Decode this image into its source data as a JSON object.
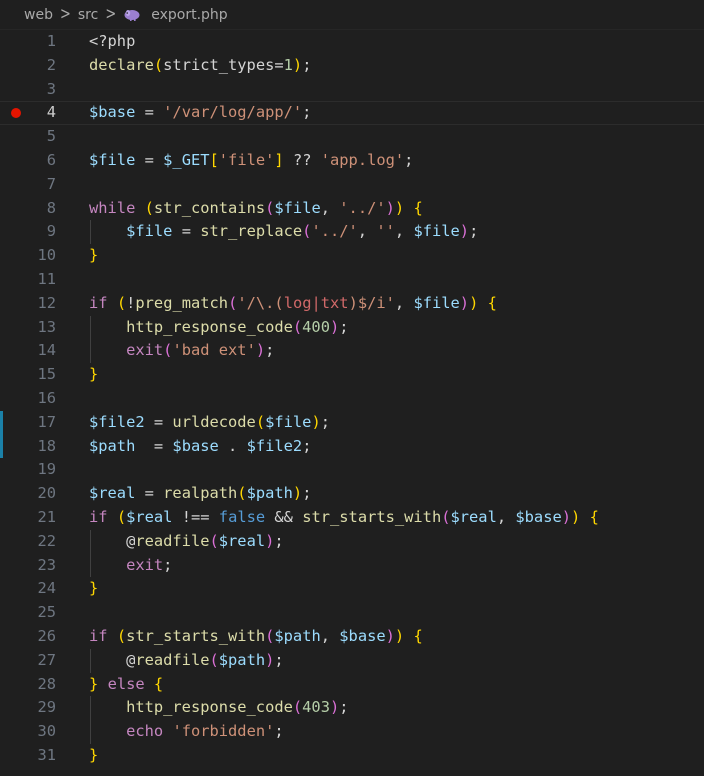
{
  "breadcrumb": {
    "parts": [
      "web",
      "src"
    ],
    "file": "export.php"
  },
  "editor": {
    "current_line": 4,
    "breakpoint_line": 4,
    "modified_lines": [
      17,
      18
    ],
    "lines": [
      {
        "n": "1",
        "tokens": [
          [
            "op",
            "<?php"
          ]
        ]
      },
      {
        "n": "2",
        "tokens": [
          [
            "fn",
            "declare"
          ],
          [
            "b1",
            "("
          ],
          [
            "op",
            "strict_types="
          ],
          [
            "n",
            "1"
          ],
          [
            "b1",
            ")"
          ],
          [
            "op",
            ";"
          ]
        ]
      },
      {
        "n": "3",
        "tokens": []
      },
      {
        "n": "4",
        "tokens": [
          [
            "v",
            "$base"
          ],
          [
            "op",
            " = "
          ],
          [
            "s",
            "'/var/log/app/'"
          ],
          [
            "op",
            ";"
          ]
        ]
      },
      {
        "n": "5",
        "tokens": []
      },
      {
        "n": "6",
        "tokens": [
          [
            "v",
            "$file"
          ],
          [
            "op",
            " = "
          ],
          [
            "v",
            "$_GET"
          ],
          [
            "b1",
            "["
          ],
          [
            "s",
            "'file'"
          ],
          [
            "b1",
            "]"
          ],
          [
            "op",
            " ?? "
          ],
          [
            "s",
            "'app.log'"
          ],
          [
            "op",
            ";"
          ]
        ]
      },
      {
        "n": "7",
        "tokens": []
      },
      {
        "n": "8",
        "tokens": [
          [
            "ctl",
            "while"
          ],
          [
            "op",
            " "
          ],
          [
            "b1",
            "("
          ],
          [
            "fn",
            "str_contains"
          ],
          [
            "b2",
            "("
          ],
          [
            "v",
            "$file"
          ],
          [
            "op",
            ", "
          ],
          [
            "s",
            "'../'"
          ],
          [
            "b2",
            ")"
          ],
          [
            "b1",
            ")"
          ],
          [
            "op",
            " "
          ],
          [
            "b1",
            "{"
          ]
        ]
      },
      {
        "n": "9",
        "tokens": [
          [
            "op",
            "    "
          ],
          [
            "v",
            "$file"
          ],
          [
            "op",
            " = "
          ],
          [
            "fn",
            "str_replace"
          ],
          [
            "b2",
            "("
          ],
          [
            "s",
            "'../'"
          ],
          [
            "op",
            ", "
          ],
          [
            "s",
            "''"
          ],
          [
            "op",
            ", "
          ],
          [
            "v",
            "$file"
          ],
          [
            "b2",
            ")"
          ],
          [
            "op",
            ";"
          ]
        ]
      },
      {
        "n": "10",
        "tokens": [
          [
            "b1",
            "}"
          ]
        ]
      },
      {
        "n": "11",
        "tokens": []
      },
      {
        "n": "12",
        "tokens": [
          [
            "ctl",
            "if"
          ],
          [
            "op",
            " "
          ],
          [
            "b1",
            "("
          ],
          [
            "op",
            "!"
          ],
          [
            "fn",
            "preg_match"
          ],
          [
            "b2",
            "("
          ],
          [
            "s",
            "'/\\.("
          ],
          [
            "re",
            "log|txt"
          ],
          [
            "s",
            ")$/i'"
          ],
          [
            "op",
            ", "
          ],
          [
            "v",
            "$file"
          ],
          [
            "b2",
            ")"
          ],
          [
            "b1",
            ")"
          ],
          [
            "op",
            " "
          ],
          [
            "b1",
            "{"
          ]
        ]
      },
      {
        "n": "13",
        "tokens": [
          [
            "op",
            "    "
          ],
          [
            "fn",
            "http_response_code"
          ],
          [
            "b2",
            "("
          ],
          [
            "n",
            "400"
          ],
          [
            "b2",
            ")"
          ],
          [
            "op",
            ";"
          ]
        ]
      },
      {
        "n": "14",
        "tokens": [
          [
            "op",
            "    "
          ],
          [
            "ctl",
            "exit"
          ],
          [
            "b2",
            "("
          ],
          [
            "s",
            "'bad ext'"
          ],
          [
            "b2",
            ")"
          ],
          [
            "op",
            ";"
          ]
        ]
      },
      {
        "n": "15",
        "tokens": [
          [
            "b1",
            "}"
          ]
        ]
      },
      {
        "n": "16",
        "tokens": []
      },
      {
        "n": "17",
        "tokens": [
          [
            "v",
            "$file2"
          ],
          [
            "op",
            " = "
          ],
          [
            "fn",
            "urldecode"
          ],
          [
            "b1",
            "("
          ],
          [
            "v",
            "$file"
          ],
          [
            "b1",
            ")"
          ],
          [
            "op",
            ";"
          ]
        ]
      },
      {
        "n": "18",
        "tokens": [
          [
            "v",
            "$path"
          ],
          [
            "op",
            "  = "
          ],
          [
            "v",
            "$base"
          ],
          [
            "op",
            " . "
          ],
          [
            "v",
            "$file2"
          ],
          [
            "op",
            ";"
          ]
        ]
      },
      {
        "n": "19",
        "tokens": []
      },
      {
        "n": "20",
        "tokens": [
          [
            "v",
            "$real"
          ],
          [
            "op",
            " = "
          ],
          [
            "fn",
            "realpath"
          ],
          [
            "b1",
            "("
          ],
          [
            "v",
            "$path"
          ],
          [
            "b1",
            ")"
          ],
          [
            "op",
            ";"
          ]
        ]
      },
      {
        "n": "21",
        "tokens": [
          [
            "ctl",
            "if"
          ],
          [
            "op",
            " "
          ],
          [
            "b1",
            "("
          ],
          [
            "v",
            "$real"
          ],
          [
            "op",
            " !== "
          ],
          [
            "kw",
            "false"
          ],
          [
            "op",
            " && "
          ],
          [
            "fn",
            "str_starts_with"
          ],
          [
            "b2",
            "("
          ],
          [
            "v",
            "$real"
          ],
          [
            "op",
            ", "
          ],
          [
            "v",
            "$base"
          ],
          [
            "b2",
            ")"
          ],
          [
            "b1",
            ")"
          ],
          [
            "op",
            " "
          ],
          [
            "b1",
            "{"
          ]
        ]
      },
      {
        "n": "22",
        "tokens": [
          [
            "op",
            "    @"
          ],
          [
            "fn",
            "readfile"
          ],
          [
            "b2",
            "("
          ],
          [
            "v",
            "$real"
          ],
          [
            "b2",
            ")"
          ],
          [
            "op",
            ";"
          ]
        ]
      },
      {
        "n": "23",
        "tokens": [
          [
            "op",
            "    "
          ],
          [
            "ctl",
            "exit"
          ],
          [
            "op",
            ";"
          ]
        ]
      },
      {
        "n": "24",
        "tokens": [
          [
            "b1",
            "}"
          ]
        ]
      },
      {
        "n": "25",
        "tokens": []
      },
      {
        "n": "26",
        "tokens": [
          [
            "ctl",
            "if"
          ],
          [
            "op",
            " "
          ],
          [
            "b1",
            "("
          ],
          [
            "fn",
            "str_starts_with"
          ],
          [
            "b2",
            "("
          ],
          [
            "v",
            "$path"
          ],
          [
            "op",
            ", "
          ],
          [
            "v",
            "$base"
          ],
          [
            "b2",
            ")"
          ],
          [
            "b1",
            ")"
          ],
          [
            "op",
            " "
          ],
          [
            "b1",
            "{"
          ]
        ]
      },
      {
        "n": "27",
        "tokens": [
          [
            "op",
            "    @"
          ],
          [
            "fn",
            "readfile"
          ],
          [
            "b2",
            "("
          ],
          [
            "v",
            "$path"
          ],
          [
            "b2",
            ")"
          ],
          [
            "op",
            ";"
          ]
        ]
      },
      {
        "n": "28",
        "tokens": [
          [
            "b1",
            "}"
          ],
          [
            "op",
            " "
          ],
          [
            "ctl",
            "else"
          ],
          [
            "op",
            " "
          ],
          [
            "b1",
            "{"
          ]
        ]
      },
      {
        "n": "29",
        "tokens": [
          [
            "op",
            "    "
          ],
          [
            "fn",
            "http_response_code"
          ],
          [
            "b2",
            "("
          ],
          [
            "n",
            "403"
          ],
          [
            "b2",
            ")"
          ],
          [
            "op",
            ";"
          ]
        ]
      },
      {
        "n": "30",
        "tokens": [
          [
            "op",
            "    "
          ],
          [
            "ctl",
            "echo"
          ],
          [
            "op",
            " "
          ],
          [
            "s",
            "'forbidden'"
          ],
          [
            "op",
            ";"
          ]
        ]
      },
      {
        "n": "31",
        "tokens": [
          [
            "b1",
            "}"
          ]
        ]
      }
    ]
  },
  "colors": {
    "background": "#1f1f1f",
    "breakpoint": "#e51400",
    "modified_gutter": "#1b81a8"
  }
}
